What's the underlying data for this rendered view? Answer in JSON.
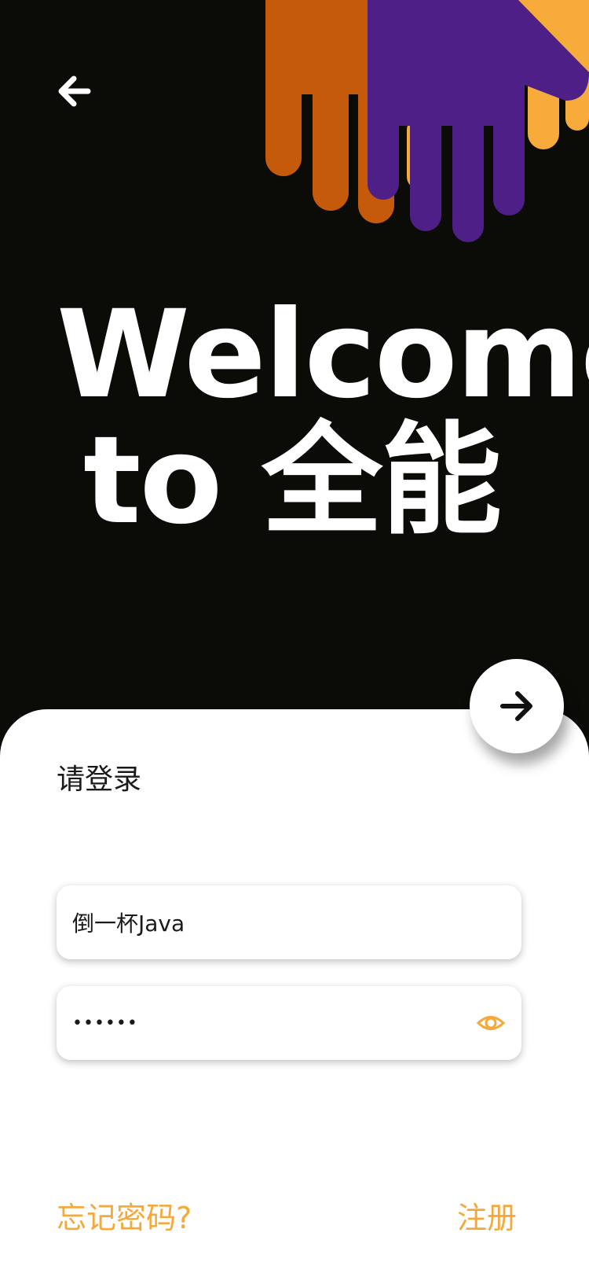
{
  "hero": {
    "title_line1": "Welcome",
    "title_line2": "to 全能",
    "back_icon": "arrow-left-icon",
    "illustration": "hands-illustration"
  },
  "login": {
    "title": "请登录",
    "submit_icon": "arrow-right-icon",
    "username_value": "倒一杯Java",
    "password_value": "••••••",
    "password_toggle_icon": "eye-icon",
    "forgot_password": "忘记密码?",
    "register": "注册"
  },
  "colors": {
    "background_dark": "#0b0b08",
    "accent_orange": "#f4a93a",
    "hand_orange": "#c55a0a",
    "hand_purple": "#4e1f87",
    "hand_yellow": "#f6ab3b"
  }
}
